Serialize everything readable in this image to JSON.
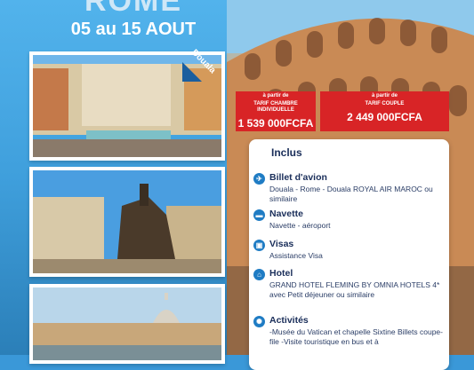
{
  "header": {
    "title": "ROME",
    "dates": "05 au 15 AOUT"
  },
  "ribbon": {
    "city": "Douala"
  },
  "prices": [
    {
      "prefix": "à partir de",
      "label": "TARIF CHAMBRE INDIVIDUELLE",
      "amount": "1 539 000FCFA"
    },
    {
      "prefix": "à partir de",
      "label": "TARIF COUPLE",
      "amount": "2 449 000FCFA"
    }
  ],
  "panel": {
    "title": "Inclus",
    "sections": [
      {
        "icon": "plane-icon",
        "glyph": "✈",
        "title": "Billet d'avion",
        "text": "Douala - Rome - Douala ROYAL AIR MAROC ou similaire"
      },
      {
        "icon": "bus-icon",
        "glyph": "▬",
        "title": "Navette",
        "text": "Navette - aéroport"
      },
      {
        "icon": "visa-icon",
        "glyph": "▣",
        "title": "Visas",
        "text": "Assistance Visa"
      },
      {
        "icon": "hotel-icon",
        "glyph": "⌂",
        "title": "Hotel",
        "text": "GRAND HOTEL FLEMING BY OMNIA HOTELS 4* avec Petit déjeuner ou similaire"
      },
      {
        "icon": "activities-icon",
        "glyph": "✺",
        "title": "Activités",
        "text": "-Musée du Vatican et chapelle Sixtine Billets coupe-file -Visite touristique en bus et à"
      }
    ]
  },
  "colors": {
    "accent": "#1f7cc4",
    "price_bg": "#d82426",
    "navy": "#1a2e5a"
  }
}
